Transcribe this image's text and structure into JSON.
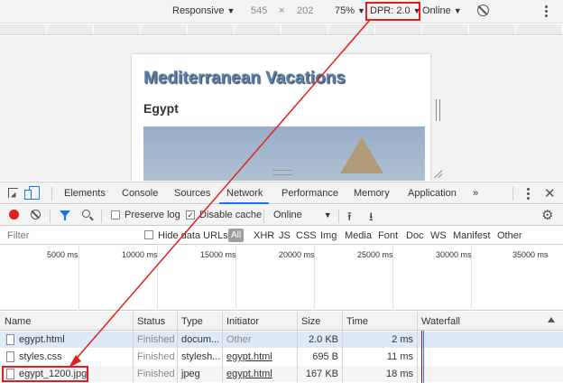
{
  "device_toolbar": {
    "mode": "Responsive",
    "width": "545",
    "times": "×",
    "height": "202",
    "zoom": "75%",
    "dpr": "DPR: 2.0",
    "throttle": "Online"
  },
  "site": {
    "title": "Mediterranean Vacations",
    "subtitle": "Egypt"
  },
  "devtools_tabs": [
    "Elements",
    "Console",
    "Sources",
    "Network",
    "Performance",
    "Memory",
    "Application",
    "»"
  ],
  "network_toolbar": {
    "preserve_log": "Preserve log",
    "disable_cache": "Disable cache",
    "throttle": "Online"
  },
  "filter_bar": {
    "placeholder": "Filter",
    "hide_data_urls": "Hide data URLs",
    "all": "All",
    "types": [
      "XHR",
      "JS",
      "CSS",
      "Img",
      "Media",
      "Font",
      "Doc",
      "WS",
      "Manifest",
      "Other"
    ]
  },
  "timeline_ticks": [
    "5000 ms",
    "10000 ms",
    "15000 ms",
    "20000 ms",
    "25000 ms",
    "30000 ms",
    "35000 ms"
  ],
  "table": {
    "headers": [
      "Name",
      "Status",
      "Type",
      "Initiator",
      "Size",
      "Time",
      "Waterfall"
    ],
    "rows": [
      {
        "name": "egypt.html",
        "status": "Finished",
        "type": "docum...",
        "initiator": "Other",
        "size": "2.0 KB",
        "time": "2 ms"
      },
      {
        "name": "styles.css",
        "status": "Finished",
        "type": "stylesh...",
        "initiator": "egypt.html",
        "size": "695 B",
        "time": "11 ms"
      },
      {
        "name": "egypt_1200.jpg",
        "status": "Finished",
        "type": "jpeg",
        "initiator": "egypt.html",
        "size": "167 KB",
        "time": "18 ms"
      }
    ]
  },
  "colors": {
    "annotation": "#e02020",
    "accent": "#1a73e8",
    "record": "#e02020",
    "selected_row": "#dde9f8"
  }
}
